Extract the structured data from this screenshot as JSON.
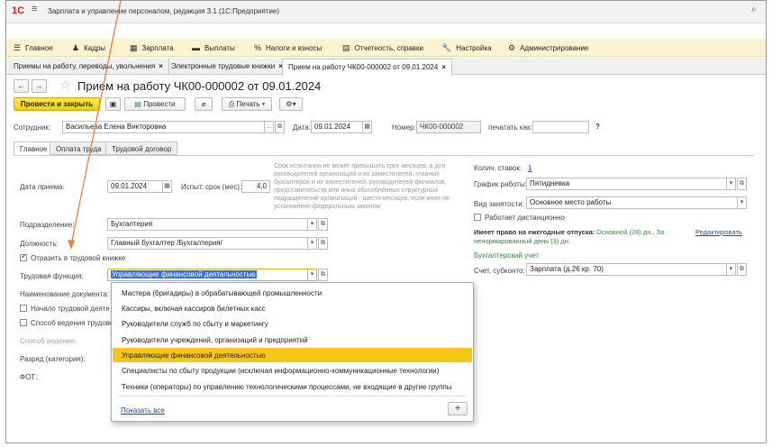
{
  "window": {
    "title": "Зарплата и управление персоналом, редакция 3.1  (1С:Предприятие)"
  },
  "menu": [
    {
      "icon": "≡",
      "label": "Главное"
    },
    {
      "icon": "👥",
      "label": "Кадры"
    },
    {
      "icon": "▦",
      "label": "Зарплата"
    },
    {
      "icon": "▬",
      "label": "Выплаты"
    },
    {
      "icon": "%",
      "label": "Налоги и взносы"
    },
    {
      "icon": "▤",
      "label": "Отчетность, справки"
    },
    {
      "icon": "🔧",
      "label": "Настройка"
    },
    {
      "icon": "⚙",
      "label": "Администрирование"
    }
  ],
  "open_tabs": [
    {
      "label": "Приемы на работу, переводы, увольнения"
    },
    {
      "label": "Электронные трудовые книжки"
    },
    {
      "label": "Прием на работу ЧК00-000002 от 09.01.2024"
    }
  ],
  "doc": {
    "title": "Прием на работу ЧК00-000002 от 09.01.2024",
    "post_close": "Провести и закрыть",
    "post": "Провести",
    "print": "Печать",
    "employee_label": "Сотрудник:",
    "employee_value": "Васильева Елена Викторовна",
    "date_label": "Дата:",
    "date_value": "09.01.2024",
    "number_label": "Номер:",
    "number_value": "ЧК00-000002",
    "print_as_label": "печатать как:",
    "help": "?"
  },
  "form_tabs": [
    "Главное",
    "Оплата труда",
    "Трудовой договор"
  ],
  "left": {
    "hire_date_label": "Дата приема:",
    "hire_date_value": "09.01.2024",
    "trial_label": "Испыт. срок (мес):",
    "trial_value": "4,0",
    "trial_hint": "Срок испытания не может превышать трех месяцев, а для руководителей организаций и их заместителей, главных бухгалтеров и их заместителей, руководителей филиалов, представительств или иных обособленных структурных подразделений организаций - шести месяцев, если иное не установлено федеральным законом",
    "dept_label": "Подразделение:",
    "dept_value": "Бухгалтерия",
    "position_label": "Должность:",
    "position_value": "Главный бухгалтер /Бухгалтерия/",
    "reflect_label": "Отразить в трудовой книжке",
    "labor_func_label": "Трудовая функция:",
    "labor_func_value": "Управляющие финансовой деятельностью",
    "doc_name_label": "Наименование документа:",
    "start_activity_label": "Начало трудовой деяте",
    "method_label": "Способ ведения трудово",
    "method_value_label": "Способ ведения:",
    "grade_label": "Разряд (категория):",
    "fot_label": "ФОТ:"
  },
  "right": {
    "rates_label": "Колич. ставок:",
    "rates_value": "1",
    "schedule_label": "График работы:",
    "schedule_value": "Пятидневка",
    "employment_label": "Вид занятости:",
    "employment_value": "Основное место работы",
    "remote_label": "Работает дистанционно",
    "vacation_label": "Имеет право на ежегодные отпуска:",
    "vacation_value": "Основной (28) дн., За ненормированный день (3) дн.",
    "edit_link": "Редактировать",
    "accounting_label": "Бухгалтерский учет",
    "account_label": "Счет, субконто:",
    "account_value": "Зарплата (д.26 кр. 70)"
  },
  "dropdown": {
    "items": [
      "Мастера (бригадиры) в обрабатывающей промышленности",
      "Кассиры, включая кассиров билетных касс",
      "Руководители служб по сбыту и маркетингу",
      "Руководители учреждений, организаций и предприятий",
      "Управляющие финансовой деятельностью",
      "Специалисты по сбыту продукции (исключая информационно-коммуникационные технологии)",
      "Техники (операторы) по управлению технологическими процессами, не входящие в другие группы"
    ],
    "selected_index": 4,
    "show_all": "Показать все",
    "add": "+"
  },
  "colors": {
    "accent_yellow": "#f5c518",
    "menu_bg": "#fbf3cf",
    "arrow": "#e8823a",
    "link": "#1b4fa8",
    "green": "#2e8b3e"
  }
}
